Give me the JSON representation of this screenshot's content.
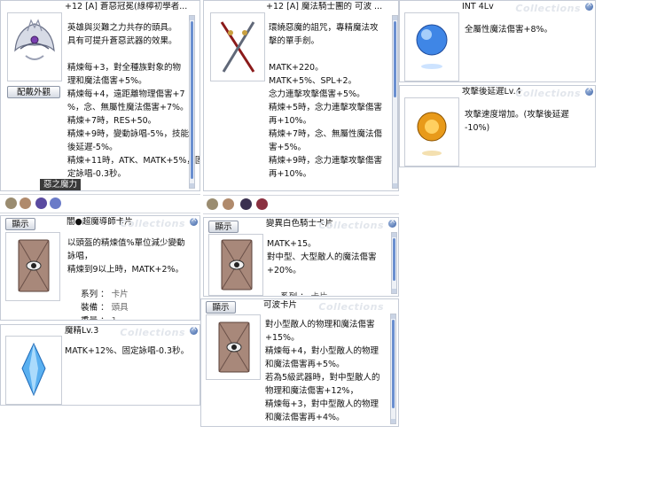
{
  "watermark": "Collections",
  "helm_window": {
    "title": "+12 [A] 蒼惡冠冕(綠檸初學者...",
    "description": "英雄與災難之力共存的頭具。\n具有可提升蒼惡武器的效果。\n\n精煉每+3，對全種族對象的物\n理和魔法傷害+5%。\n精煉每+4，遠距離物理傷害+7\n%，念、無屬性魔法傷害+7%。\n精煉+7時，RES+50。\n精煉+9時，變動詠唱-5%，技能\n後延遲-5%。\n精煉+11時，ATK、MATK+5%，固\n定詠唱-0.3秒。",
    "appearance_button": "配戴外觀",
    "tab_label": "惡之魔力",
    "item_image": "tiara-helm-icon"
  },
  "weapon_window": {
    "title": "+12 [A] 魔法騎士團的 可波 ...",
    "description": "環繞惡魔的詛咒，專精魔法攻\n擊的單手劍。\n\nMATK+220。\nMATK+5%、SPL+2。\n念力連擊攻擊傷害+5%。\n精煉+5時，念力連擊攻擊傷害\n再+10%。\n精煉+7時，念、無屬性魔法傷\n害+5%。\n精煉+9時，念力連擊攻擊傷害\n再+10%。",
    "item_image": "dual-sword-icon"
  },
  "int_window": {
    "title": "INT 4Lv",
    "description": "全屬性魔法傷害+8%。",
    "item_image": "blue-orb-icon"
  },
  "aspd_window": {
    "title": "攻擊後延遲Lv.4",
    "description": "攻擊速度增加。(攻擊後延遲\n-10%)",
    "item_image": "gold-orb-icon"
  },
  "card1_window": {
    "title": "闇●超魔導師卡片",
    "display_button": "顯示",
    "description": "以頭盔的精煉值%單位減少變動\n詠唱，\n精煉到9以上時，MATK+2%。",
    "rows": [
      {
        "key": "系列",
        "value": "卡片"
      },
      {
        "key": "裝備",
        "value": "頭具"
      },
      {
        "key": "重量",
        "value": "1"
      }
    ]
  },
  "card2_window": {
    "title": "變異白色騎士卡片",
    "display_button": "顯示",
    "description": "MATK+15。\n對中型、大型敵人的魔法傷害\n+20%。",
    "rows": [
      {
        "key": "系列",
        "value": "卡片"
      }
    ]
  },
  "card3_window": {
    "title": "可波卡片",
    "display_button": "顯示",
    "description": "對小型敵人的物理和魔法傷害\n+15%。\n精煉每+4，對小型敵人的物理\n和魔法傷害再+5%。\n若為5級武器時，對中型敵人的\n物理和魔法傷害+12%，\n精煉每+3，對中型敵人的物理\n和魔法傷害再+4%。"
  },
  "crystal_window": {
    "title": "魔精Lv.3",
    "description": "MATK+12%、固定詠唱-0.3秒。",
    "item_image": "crystal-icon"
  },
  "colors": {
    "border": "#c5cbd6",
    "scroll_thumb": "#6a8fd0",
    "tab_bg": "#3a3a3a"
  }
}
